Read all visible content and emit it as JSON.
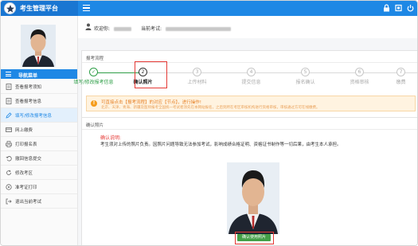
{
  "app": {
    "title": "考生管理平台"
  },
  "sidebar": {
    "nav_header": "导航菜单",
    "items": [
      {
        "label": "查看报考须知",
        "icon": "document-icon"
      },
      {
        "label": "查看报考信息",
        "icon": "document-icon"
      },
      {
        "label": "填写/修改报考信息",
        "icon": "edit-icon",
        "active": true
      },
      {
        "label": "网上缴费",
        "icon": "payment-icon"
      },
      {
        "label": "打印报名表",
        "icon": "print-icon"
      },
      {
        "label": "撤回信息提交",
        "icon": "undo-icon"
      },
      {
        "label": "修改考区",
        "icon": "refresh-icon"
      },
      {
        "label": "准考证打印",
        "icon": "ticket-icon"
      },
      {
        "label": "退出当前考试",
        "icon": "exit-icon"
      }
    ]
  },
  "welcome": {
    "greeting": "欢迎你:",
    "exam_label": "当前考试:"
  },
  "process": {
    "title": "报考流程",
    "steps": [
      {
        "num": "✓",
        "label": "填写/修改报考信息",
        "status": "done"
      },
      {
        "num": "2",
        "label": "确认照片",
        "status": "current"
      },
      {
        "num": "3",
        "label": "上传材料",
        "status": "todo"
      },
      {
        "num": "4",
        "label": "提交信息",
        "status": "todo"
      },
      {
        "num": "5",
        "label": "报名确认",
        "status": "todo"
      },
      {
        "num": "6",
        "label": "资格审核",
        "status": "todo"
      },
      {
        "num": "7",
        "label": "缴费",
        "status": "todo"
      }
    ],
    "warning_line1": "可直接点击【报考流程】的对应【节点】，进行操作!",
    "warning_line2": "北京、天津、青海、新疆及医师报考全国统一考试者须先在本网站报名，之后到所在考区审核机构进行资格审核，审核通过方可在线缴费。"
  },
  "photo_panel": {
    "title": "确认照片",
    "confirm_label": "确认说明:",
    "confirm_text": "考生须对上传的照片负责。因照片问题导致无法参加考试，影响成绩合格证明、资格证书制作等一切后果，由考生本人承担。",
    "confirm_button": "确认使用照片"
  },
  "colors": {
    "brand": "#1e88e5",
    "done": "#2e9e47",
    "alert": "#e53935",
    "button": "#43a047"
  }
}
